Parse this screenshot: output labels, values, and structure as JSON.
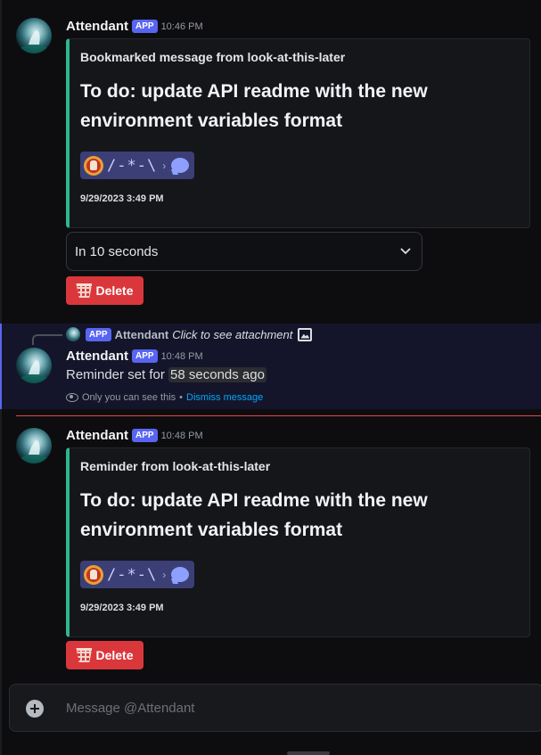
{
  "messages": [
    {
      "username": "Attendant",
      "badge": "APP",
      "time": "10:46 PM",
      "embed": {
        "author": "Bookmarked message from look-at-this-later",
        "title": "To do: update API readme with the new environment variables format",
        "chip_text": "/-*-\\",
        "chip_arrow": "›",
        "date": "9/29/2023 3:49 PM"
      },
      "select_value": "In 10 seconds",
      "delete_label": "Delete"
    },
    {
      "reply": {
        "badge": "APP",
        "username": "Attendant",
        "text": "Click to see attachment"
      },
      "username": "Attendant",
      "badge": "APP",
      "time": "10:48 PM",
      "text_prefix": "Reminder set for",
      "timestamp": "58 seconds ago",
      "ephemeral_note": "Only you can see this",
      "ephemeral_sep": "•",
      "dismiss_label": "Dismiss message"
    },
    {
      "username": "Attendant",
      "badge": "APP",
      "time": "10:48 PM",
      "embed": {
        "author": "Reminder from look-at-this-later",
        "title": "To do: update API readme with the new environment variables format",
        "chip_text": "/-*-\\",
        "chip_arrow": "›",
        "date": "9/29/2023 3:49 PM"
      },
      "delete_label": "Delete"
    }
  ],
  "composer": {
    "placeholder": "Message @Attendant"
  },
  "colors": {
    "background": "#0d0d10",
    "embed_accent": "#2fb68c",
    "app_badge": "#5865f2",
    "danger": "#da373c",
    "link": "#00a8fc",
    "new_divider": "#e7444a"
  },
  "icons": [
    "bot-avatar",
    "chevron-down-icon",
    "basket-icon",
    "image-icon",
    "eye-icon",
    "plus-circle-icon",
    "chat-bubble-icon"
  ]
}
